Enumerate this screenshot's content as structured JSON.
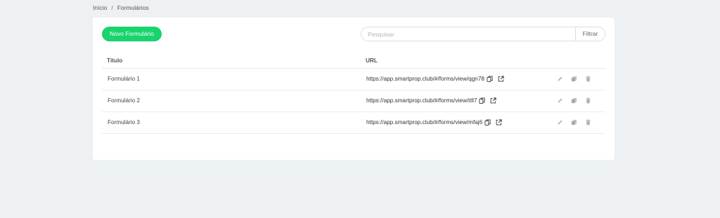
{
  "breadcrumb": {
    "home": "Início",
    "separator": "/",
    "current": "Formulários"
  },
  "toolbar": {
    "new_label": "Novo Formulário",
    "search_placeholder": "Pesquisar",
    "filter_label": "Filtrar"
  },
  "table": {
    "headers": {
      "title": "Título",
      "url": "URL"
    },
    "rows": [
      {
        "title": "Formulário 1",
        "url": "https://app.smartprop.club/#/forms/view/qgn78"
      },
      {
        "title": "Formulário 2",
        "url": "https://app.smartprop.club/#/forms/view/itll7"
      },
      {
        "title": "Formulário 3",
        "url": "https://app.smartprop.club/#/forms/view/mfaj6"
      }
    ]
  },
  "icons": {
    "copy": "copy-icon",
    "external": "external-link-icon",
    "edit": "pencil-icon",
    "duplicate": "duplicate-icon",
    "delete": "trash-icon"
  },
  "colors": {
    "accent": "#19d36d",
    "background": "#edf1f4",
    "icon_muted": "#b8b8b8"
  }
}
